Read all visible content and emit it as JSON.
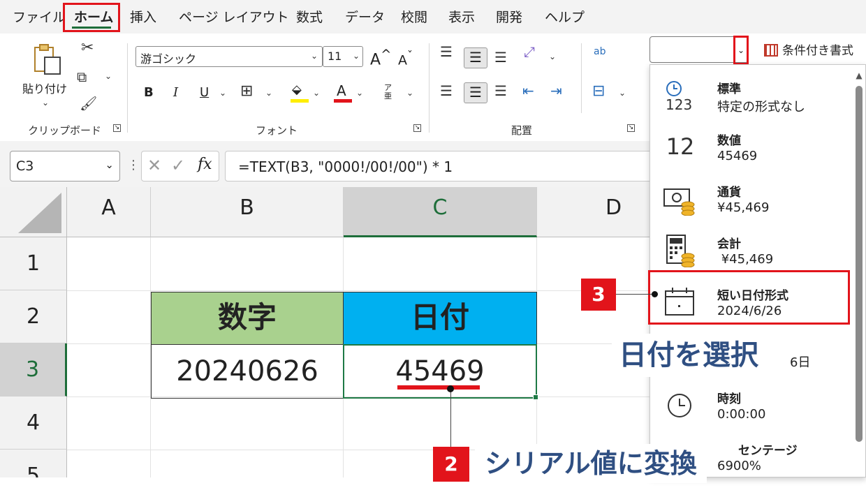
{
  "menu": {
    "items": [
      "ファイル",
      "ホーム",
      "挿入",
      "ページ レイアウト",
      "数式",
      "データ",
      "校閲",
      "表示",
      "開発",
      "ヘルプ"
    ]
  },
  "ribbon": {
    "clipboard": {
      "paste_label": "貼り付け",
      "group_label": "クリップボード"
    },
    "font": {
      "font_name": "游ゴシック",
      "font_size": "11",
      "grow_label": "A",
      "shrink_label": "A",
      "bold": "B",
      "italic": "I",
      "underline": "U",
      "font_color_glyph": "A",
      "phonetic_glyph": "ア亜",
      "group_label": "フォント"
    },
    "alignment": {
      "group_label": "配置",
      "wrap_glyph": "ab",
      "orientation_glyph": "ab"
    },
    "styles": {
      "conditional_format": "条件付き書式"
    }
  },
  "formula_bar": {
    "name_box": "C3",
    "fx_label": "fx",
    "formula": "=TEXT(B3, \"0000!/00!/00\") * 1"
  },
  "grid": {
    "columns": [
      "A",
      "B",
      "C",
      "D"
    ],
    "selected_column": "C",
    "rows": [
      "1",
      "2",
      "3",
      "4",
      "5"
    ],
    "selected_row": "3",
    "cells": {
      "B2": "数字",
      "C2": "日付",
      "B3": "20240626",
      "C3": "45469"
    },
    "colors": {
      "header_b_fill": "#a9d18e",
      "header_c_fill": "#00b0f0",
      "selection_green": "#1e7a45"
    }
  },
  "number_format_dropdown": {
    "current_value": "",
    "items": [
      {
        "icon": "clock-123-icon",
        "name": "標準",
        "sample": "特定の形式なし"
      },
      {
        "icon": "number-12-icon",
        "name": "数値",
        "sample": "45469"
      },
      {
        "icon": "currency-icon",
        "name": "通貨",
        "sample": "¥45,469"
      },
      {
        "icon": "calculator-icon",
        "name": "会計",
        "sample": " ¥45,469"
      },
      {
        "icon": "calendar-icon",
        "name": "短い日付形式",
        "sample": "2024/6/26"
      },
      {
        "icon": "calendar-long-icon",
        "name": "",
        "sample": "6日"
      },
      {
        "icon": "clock-icon",
        "name": "時刻",
        "sample": "0:00:00"
      },
      {
        "icon": "percent-icon",
        "name": "センテージ",
        "sample": "6900%"
      }
    ]
  },
  "annotations": {
    "step3_number": "3",
    "step3_text": "日付を選択",
    "step2_number": "2",
    "step2_text": "シリアル値に変換",
    "accent_red": "#e2141b",
    "text_blue": "#2f4f82"
  }
}
